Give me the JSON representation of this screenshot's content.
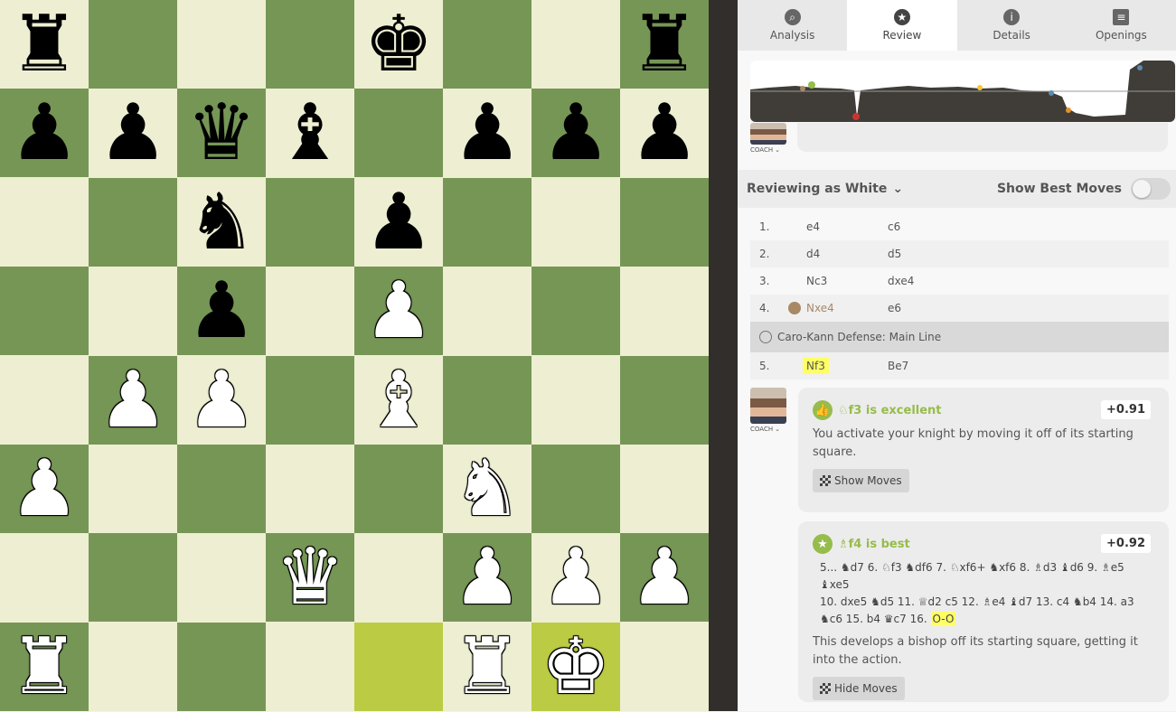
{
  "board": {
    "highlight": [
      "e1",
      "g1"
    ],
    "pieces": [
      {
        "sq": "a8",
        "p": "r"
      },
      {
        "sq": "e8",
        "p": "k"
      },
      {
        "sq": "h8",
        "p": "r"
      },
      {
        "sq": "a7",
        "p": "p"
      },
      {
        "sq": "b7",
        "p": "p"
      },
      {
        "sq": "c7",
        "p": "q"
      },
      {
        "sq": "d7",
        "p": "b"
      },
      {
        "sq": "f7",
        "p": "p"
      },
      {
        "sq": "g7",
        "p": "p"
      },
      {
        "sq": "h7",
        "p": "p"
      },
      {
        "sq": "c6",
        "p": "n"
      },
      {
        "sq": "e6",
        "p": "p"
      },
      {
        "sq": "c5",
        "p": "p"
      },
      {
        "sq": "e5",
        "p": "P"
      },
      {
        "sq": "b4",
        "p": "P"
      },
      {
        "sq": "c4",
        "p": "P"
      },
      {
        "sq": "e4",
        "p": "B"
      },
      {
        "sq": "a3",
        "p": "P"
      },
      {
        "sq": "f3",
        "p": "N"
      },
      {
        "sq": "d2",
        "p": "Q"
      },
      {
        "sq": "f2",
        "p": "P"
      },
      {
        "sq": "g2",
        "p": "P"
      },
      {
        "sq": "h2",
        "p": "P"
      },
      {
        "sq": "a1",
        "p": "R"
      },
      {
        "sq": "f1",
        "p": "R"
      },
      {
        "sq": "g1",
        "p": "K"
      }
    ]
  },
  "tabs": [
    {
      "label": "Analysis",
      "icon": "analysis-icon"
    },
    {
      "label": "Review",
      "icon": "star-icon",
      "active": true
    },
    {
      "label": "Details",
      "icon": "info-icon"
    },
    {
      "label": "Openings",
      "icon": "book-icon"
    }
  ],
  "coach_label": "COACH",
  "reviewing": {
    "label": "Reviewing as White",
    "best_label": "Show Best Moves"
  },
  "moves": [
    {
      "num": "1.",
      "white": "e4",
      "black": "c6"
    },
    {
      "num": "2.",
      "white": "d4",
      "black": "d5"
    },
    {
      "num": "3.",
      "white": "Nc3",
      "black": "dxe4"
    },
    {
      "num": "4.",
      "white": "Nxe4",
      "black": "e6",
      "book": true
    }
  ],
  "opening": "Caro-Kann Defense: Main Line",
  "move5": {
    "num": "5.",
    "white": "Nf3",
    "black": "Be7"
  },
  "card1": {
    "title": "♘f3  is excellent",
    "score": "+0.91",
    "text": "You activate your knight by moving it off of its starting square.",
    "button": "Show Moves"
  },
  "card2": {
    "title": "♗f4  is best",
    "score": "+0.92",
    "line_1": "5... ♞d7 6. ♘f3 ♞df6 7. ♘xf6+ ♞xf6 8. ♗d3 ♝d6 9. ♗e5 ♝xe5",
    "line_2": "10. dxe5 ♞d5 11. ♕d2 c5 12. ♗e4 ♝d7 13. c4 ♞b4 14. a3",
    "line_3": "♞c6 15. b4 ♛c7 16.",
    "castle": "O-O",
    "text": "This develops a bishop off its starting square, getting it into the action.",
    "button": "Hide Moves"
  },
  "colors": {
    "light": "#eeeed2",
    "dark": "#769656",
    "highlight": "#bbcb44",
    "accent": "#96bc4b",
    "book": "#a88865"
  }
}
